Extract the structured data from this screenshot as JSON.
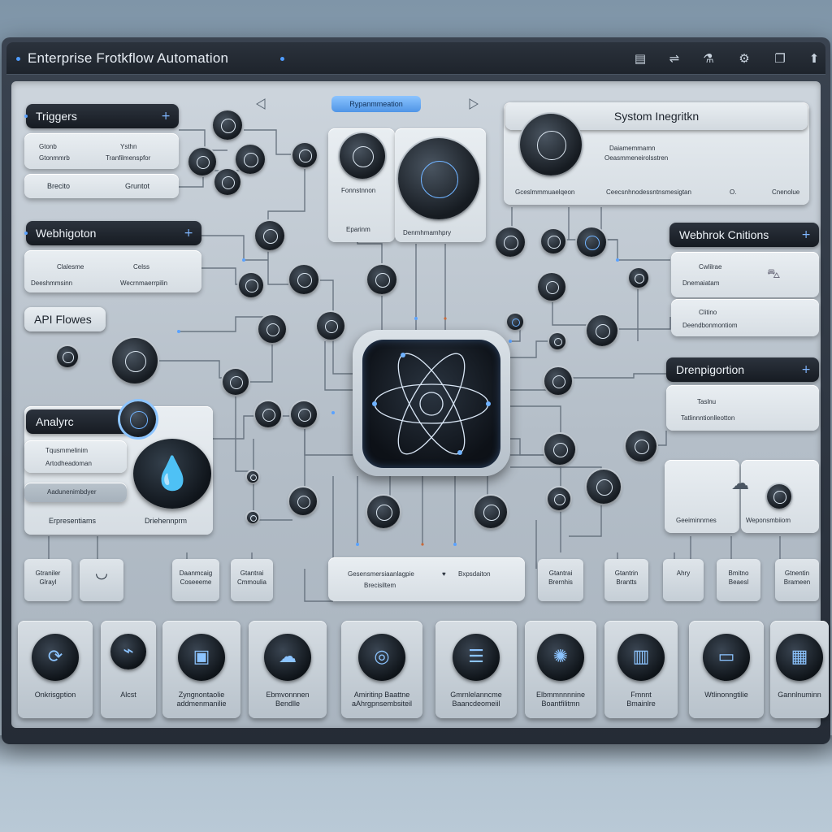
{
  "window": {
    "title": "Enterprise Frotkflow Automation",
    "toolbar_icons": [
      "document-icon",
      "share-icon",
      "flask-icon",
      "settings-icon",
      "copy-icon",
      "upload-icon"
    ]
  },
  "top_tag": "Rypanmmeation",
  "sections": {
    "triggers": {
      "title": "Triggers",
      "row1": [
        "Gtonb",
        "Ysthn"
      ],
      "row1_sub": [
        "Gtonmmrb",
        "Tranfilmenspfor"
      ],
      "row2": [
        "Brecito",
        "Gruntot"
      ]
    },
    "webhook_left": {
      "title": "Webhigoton",
      "row_a": [
        "Clalesme",
        "Celss"
      ],
      "row_b": [
        "Deeshmmsinn",
        "Wecrnmaerrpilin"
      ]
    },
    "api_flows": {
      "title": "API Flowes"
    },
    "analytics": {
      "title": "Analyrc",
      "items": [
        "Tqusmmelinim",
        "Artodheadoman",
        "Aadunenimbdyer"
      ],
      "footer": [
        "Erpresentiams",
        "Driehennprm"
      ]
    },
    "center_panel": {
      "labels": [
        "Fonnstnnon",
        "Eparinm",
        "Denmhmamhpry"
      ]
    },
    "system_integration": {
      "title": "Systom Inegritkn",
      "line1": "Daiamemmamn",
      "line2": "Oeasmmeneirolsstren",
      "footer": [
        "Gceslmmmuaelqeon",
        "Ceecsnhnodessntnsmesigtan",
        "O.",
        "Cnenolue"
      ]
    },
    "webhook_right": {
      "title": "Webhrok Cnitions",
      "card1": [
        "Cwlilrae",
        "Dnemaiatam"
      ],
      "card2": [
        "Clitino",
        "Deendbonmontiom"
      ]
    },
    "orchestration": {
      "title": "Drenpigortion",
      "lines": [
        "Taslnu",
        "Tatlinnntionlleotton"
      ]
    },
    "cloud_panel": {
      "labels": [
        "Geeiminnrnes",
        "Weponsmbiiom"
      ]
    },
    "bottom_bar_center": {
      "left": "Gesensmersiaanlagpie",
      "left2": "Brecisiltem",
      "right": "Bxpsdaiton"
    }
  },
  "mini_buttons": [
    {
      "label": "Gtraniler\nGlrayl",
      "icon": ""
    },
    {
      "label": "",
      "icon": "refresh-icon"
    },
    {
      "label": "Daanmcaig\nCoseeeme",
      "icon": ""
    },
    {
      "label": "Gtantrai\nCmmoulia",
      "icon": ""
    },
    {
      "label": "Gtantrai\nBrernhis",
      "icon": ""
    },
    {
      "label": "Gtantrin\nBrantts",
      "icon": ""
    },
    {
      "label": "Ahry",
      "icon": ""
    },
    {
      "label": "Bmitno\nBeaesl",
      "icon": ""
    },
    {
      "label": "Gtnentin\nBrameen",
      "icon": ""
    }
  ],
  "tiles": [
    {
      "label": "Onkrisgption",
      "icon": "⟳"
    },
    {
      "label": "Alcst",
      "icon": "⌁"
    },
    {
      "label": "Zyngnontaolie\naddmenmanilie",
      "icon": "▣"
    },
    {
      "label": "Ebmvonnnen\nBendlle",
      "icon": "☁"
    },
    {
      "label": "Amiritinp Baattne\naAhrgpnsembsiteil",
      "icon": "◎"
    },
    {
      "label": "Gmrnlelanncme\nBaancdeomeiil",
      "icon": "☰"
    },
    {
      "label": "Elbmmnnnnine\nBoantfilitmn",
      "icon": "✺"
    },
    {
      "label": "Fmnnt\nBmainlre",
      "icon": "▥"
    },
    {
      "label": "Wtlinonngtilie",
      "icon": "▭"
    },
    {
      "label": "Gannlnuminn",
      "icon": "▦"
    }
  ]
}
